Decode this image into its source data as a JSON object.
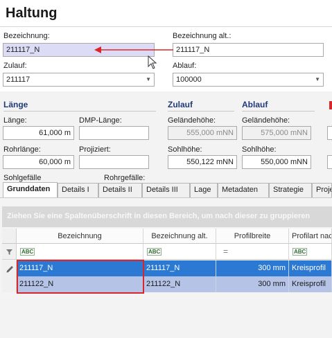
{
  "page": {
    "title": "Haltung"
  },
  "general": {
    "bezeichnung_label": "Bezeichnung:",
    "bezeichnung_value": "211117_N",
    "bezeichnung_alt_label": "Bezeichnung alt.:",
    "bezeichnung_alt_value": "211117_N",
    "zulauf_label": "Zulauf:",
    "zulauf_value": "211117",
    "ablauf_label": "Ablauf:",
    "ablauf_value": "100000"
  },
  "laenge": {
    "heading": "Länge",
    "laenge_label": "Länge:",
    "laenge_value": "61,000 m",
    "dmp_label": "DMP-Länge:",
    "dmp_value": "",
    "rohrlaenge_label": "Rohrlänge:",
    "rohrlaenge_value": "60,000 m",
    "projiziert_label": "Projiziert:",
    "projiziert_value": "",
    "sohlgefaelle_label": "Sohlgefälle",
    "rohrgefaelle_label": "Rohrgefälle:"
  },
  "zulauf": {
    "heading": "Zulauf",
    "gelaende_label": "Geländehöhe:",
    "gelaende_value": "555,000 mNN",
    "sohl_label": "Sohlhöhe:",
    "sohl_value": "550,122 mNN"
  },
  "ablauf": {
    "heading": "Ablauf",
    "gelaende_label": "Geländehöhe:",
    "gelaende_value": "575,000 mNN",
    "sohl_label": "Sohlhöhe:",
    "sohl_value": "550,000 mNN"
  },
  "tabs": [
    "Grunddaten",
    "Details I",
    "Details II",
    "Details III",
    "Lage",
    "Metadaten",
    "Strategie",
    "Proje"
  ],
  "grid": {
    "group_hint": "Ziehen Sie eine Spaltenüberschrift in diesen Bereich, um nach dieser zu gruppieren",
    "columns": [
      "Bezeichnung",
      "Bezeichnung alt.",
      "Profilbreite",
      "Profilart nac"
    ],
    "filter_equals": "=",
    "rows": [
      [
        "211117_N",
        "211117_N",
        "300 mm",
        "Kreisprofil"
      ],
      [
        "211122_N",
        "211122_N",
        "300 mm",
        "Kreisprofil"
      ]
    ]
  },
  "colors": {
    "accent": "#1f3a7a",
    "selection": "#2b79d3",
    "highlight_box": "#d9262a"
  }
}
